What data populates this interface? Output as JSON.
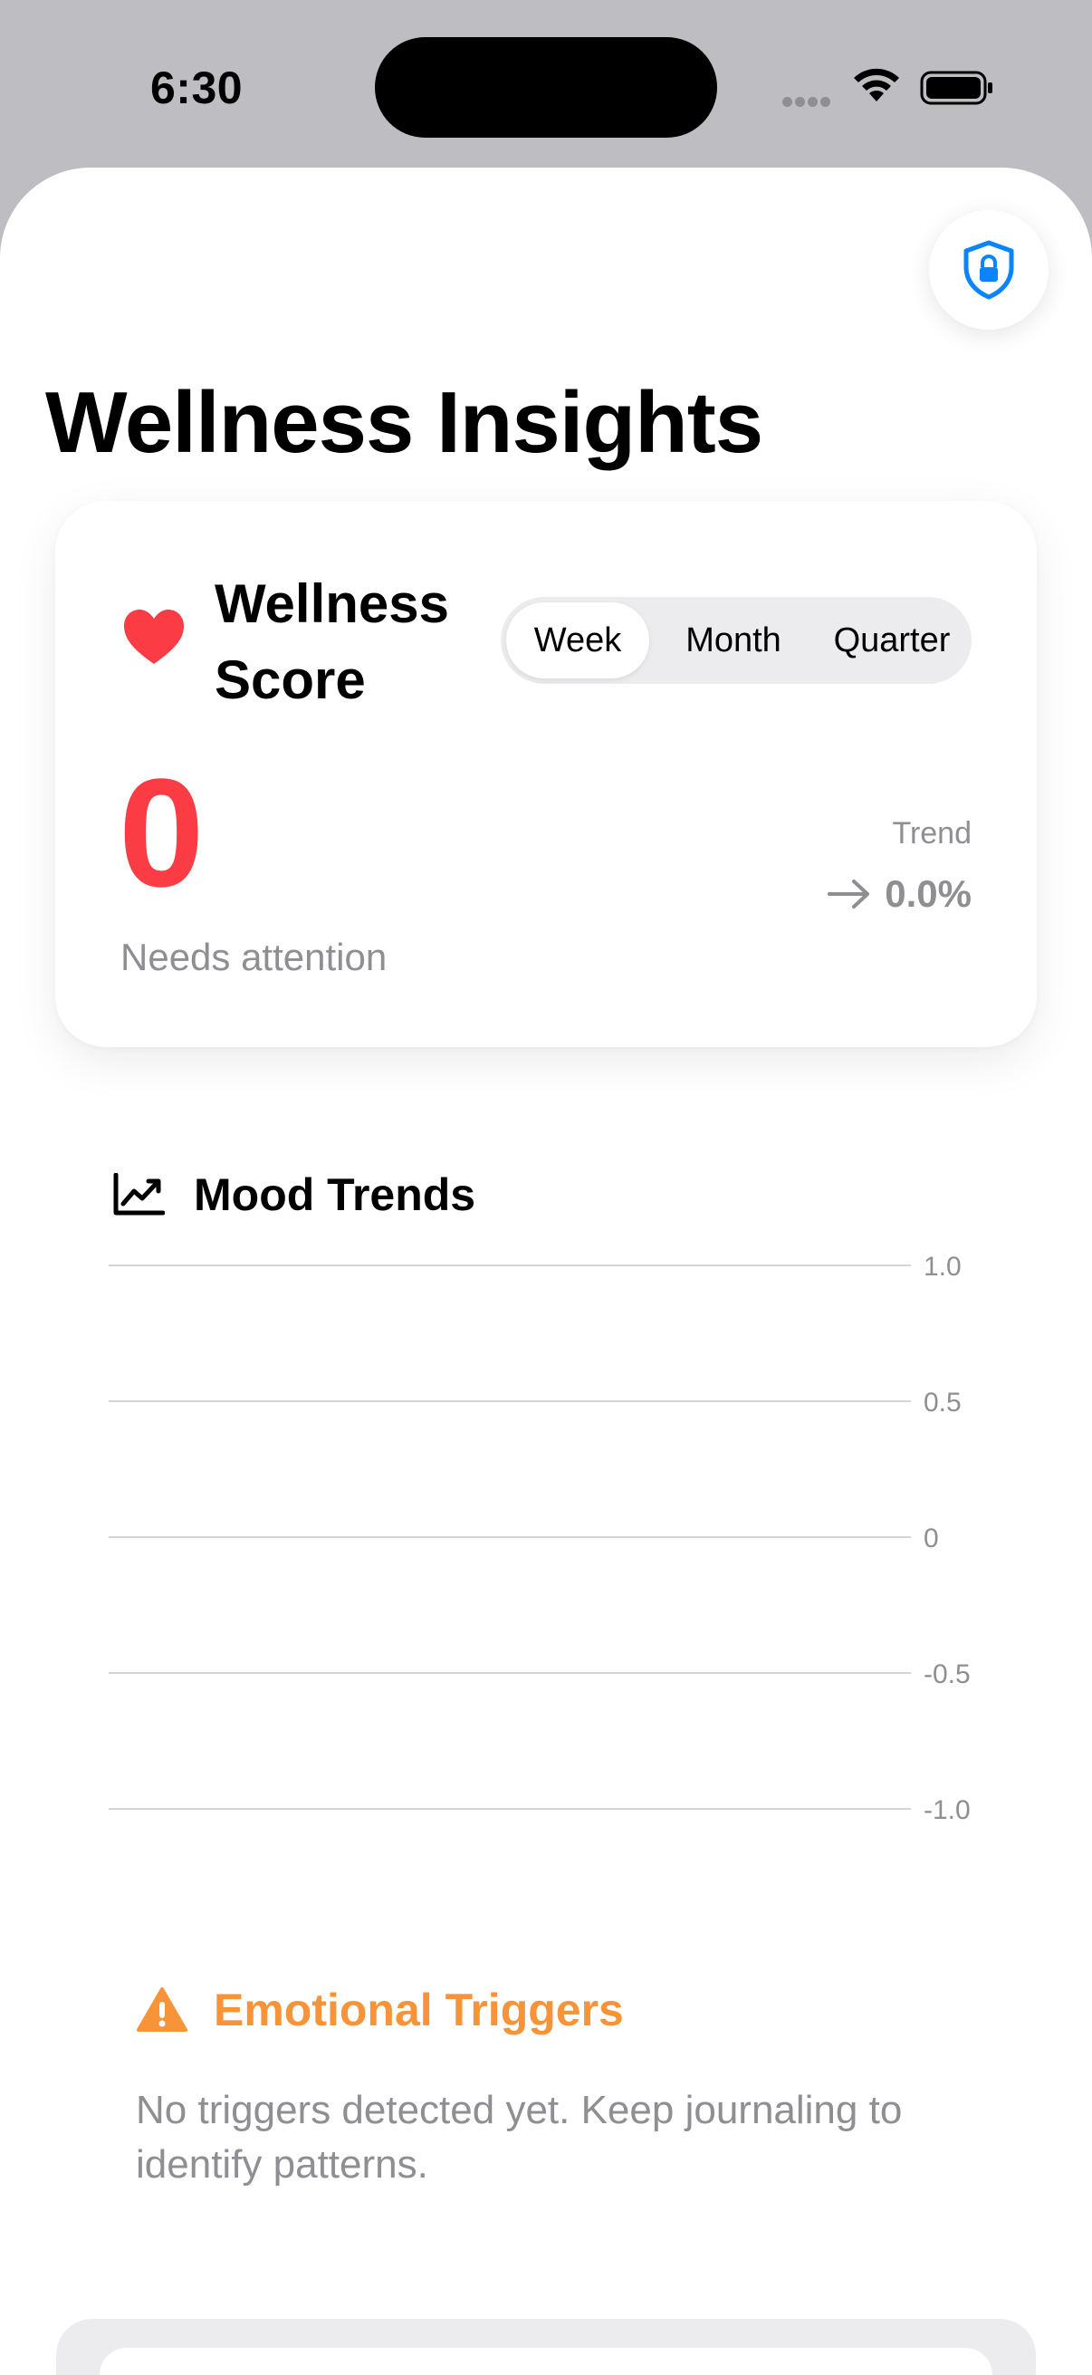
{
  "status_bar": {
    "time": "6:30"
  },
  "header": {
    "title": "Wellness Insights",
    "privacy_icon": "shield-lock-icon"
  },
  "score_card": {
    "title": "Wellness Score",
    "periods": [
      "Week",
      "Month",
      "Quarter"
    ],
    "selected_period": "Week",
    "score": "0",
    "status": "Needs attention",
    "trend_label": "Trend",
    "trend_value": "0.0%",
    "score_color": "#fb3c45"
  },
  "mood_trends": {
    "title": "Mood Trends",
    "chart_data": {
      "type": "line",
      "series": [],
      "ylim": [
        -1.0,
        1.0
      ],
      "y_ticks": [
        "1.0",
        "0.5",
        "0",
        "-0.5",
        "-1.0"
      ],
      "grid": true
    }
  },
  "triggers": {
    "title": "Emotional Triggers",
    "message": "No triggers detected yet. Keep journaling to identify patterns.",
    "accent": "#f7943a"
  },
  "colors": {
    "accent": "#0a84ff",
    "secondary_text": "#8e8e93"
  }
}
